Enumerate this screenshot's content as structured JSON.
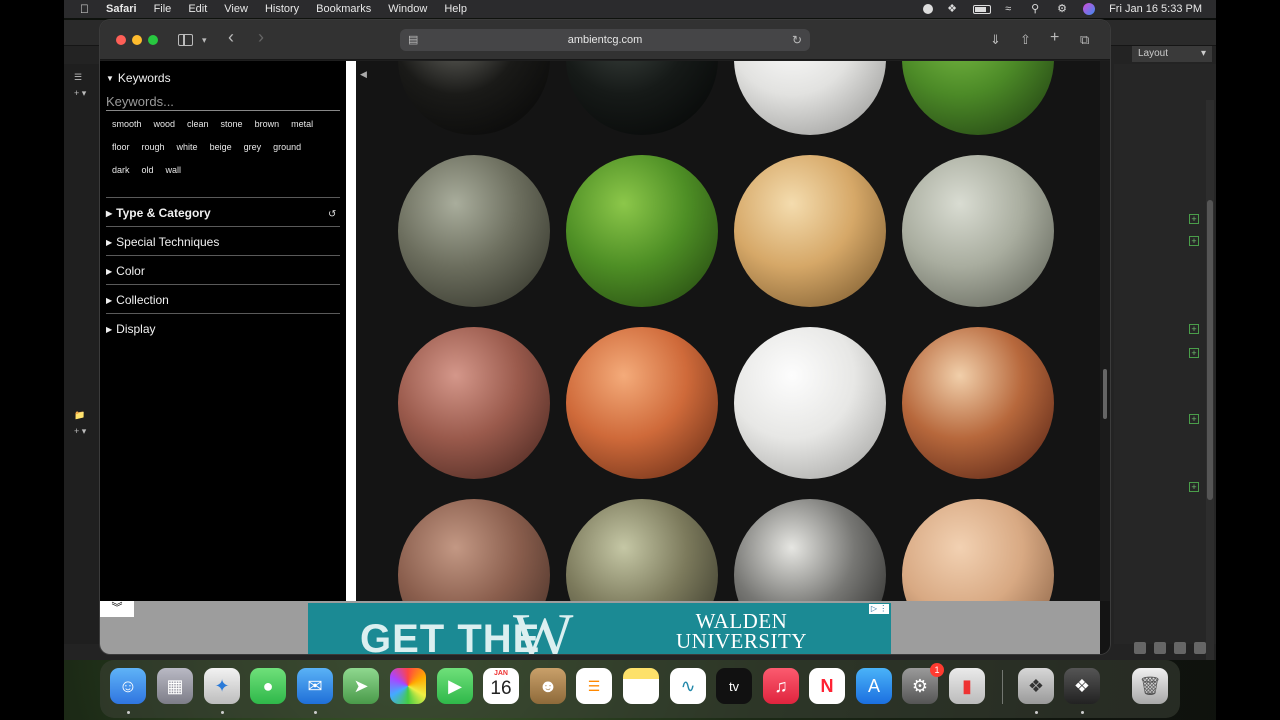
{
  "menubar": {
    "app": "Safari",
    "items": [
      "File",
      "Edit",
      "View",
      "History",
      "Bookmarks",
      "Window",
      "Help"
    ],
    "clock": "Fri Jan 16  5:33 PM"
  },
  "background_app": {
    "layout_label": "Layout"
  },
  "browser": {
    "url": "ambientcg.com"
  },
  "filters": {
    "keywords_heading": "Keywords",
    "keywords_placeholder": "Keywords...",
    "tag_rows": [
      [
        "smooth",
        "wood",
        "clean",
        "stone",
        "brown",
        "metal"
      ],
      [
        "floor",
        "rough",
        "white",
        "beige",
        "grey",
        "ground"
      ],
      [
        "dark",
        "old",
        "wall"
      ]
    ],
    "sections": [
      "Type & Category",
      "Special Techniques",
      "Color",
      "Collection",
      "Display"
    ]
  },
  "materials": [
    {
      "name": "dark-marble-sphere",
      "colors": [
        "#6c6c66",
        "#1a1a18",
        "#050505"
      ]
    },
    {
      "name": "black-granite-sphere",
      "colors": [
        "#3d4440",
        "#161a18",
        "#030404"
      ]
    },
    {
      "name": "white-plaster-sphere",
      "colors": [
        "#ffffff",
        "#e2e2e0",
        "#8d8d8b"
      ]
    },
    {
      "name": "green-grass-sphere",
      "colors": [
        "#7bbd45",
        "#4c8a27",
        "#1b3510"
      ]
    },
    {
      "name": "rock-slate-sphere",
      "colors": [
        "#a9ad9c",
        "#6c6e5e",
        "#2a2b22"
      ]
    },
    {
      "name": "moss-sphere",
      "colors": [
        "#8cc74a",
        "#4e8f25",
        "#1f3d0e"
      ]
    },
    {
      "name": "light-wood-sphere",
      "colors": [
        "#f4dcae",
        "#d6a868",
        "#6e4f26"
      ]
    },
    {
      "name": "grey-fabric-sphere",
      "colors": [
        "#d9dcd2",
        "#a9ad9f",
        "#55584e"
      ]
    },
    {
      "name": "red-brick-sphere",
      "colors": [
        "#d4978a",
        "#9a5a4c",
        "#3e201a"
      ]
    },
    {
      "name": "orange-brick-sphere",
      "colors": [
        "#f4ab7a",
        "#cf6a3a",
        "#5a2512"
      ]
    },
    {
      "name": "white-paint-sphere",
      "colors": [
        "#fdfdfd",
        "#e7e7e5",
        "#9a9a98"
      ]
    },
    {
      "name": "gold-diamond-tiles-sphere",
      "colors": [
        "#f1cfaa",
        "#b7683c",
        "#4a1a10"
      ]
    },
    {
      "name": "old-brick-sphere",
      "colors": [
        "#c39884",
        "#8a5e4d",
        "#3a2720"
      ]
    },
    {
      "name": "cobblestone-sphere",
      "colors": [
        "#c5c7a5",
        "#7c7a5c",
        "#2a2a20"
      ]
    },
    {
      "name": "silver-metal-sphere",
      "colors": [
        "#e6e6e2",
        "#777774",
        "#1a1a19"
      ]
    },
    {
      "name": "pale-wood-sphere",
      "colors": [
        "#f2d1b2",
        "#d8a983",
        "#7a5338"
      ]
    }
  ],
  "ad": {
    "close_glyph": "︾",
    "headline_left": "GET THE",
    "headline_letter": "W",
    "brand_line1": "WALDEN",
    "brand_line2": "UNIVERSITY",
    "choice_glyph": "▷ ⋮"
  },
  "dock": {
    "calendar_month": "JAN",
    "calendar_day": "16",
    "tv_label": "tv",
    "settings_badge": "1"
  }
}
